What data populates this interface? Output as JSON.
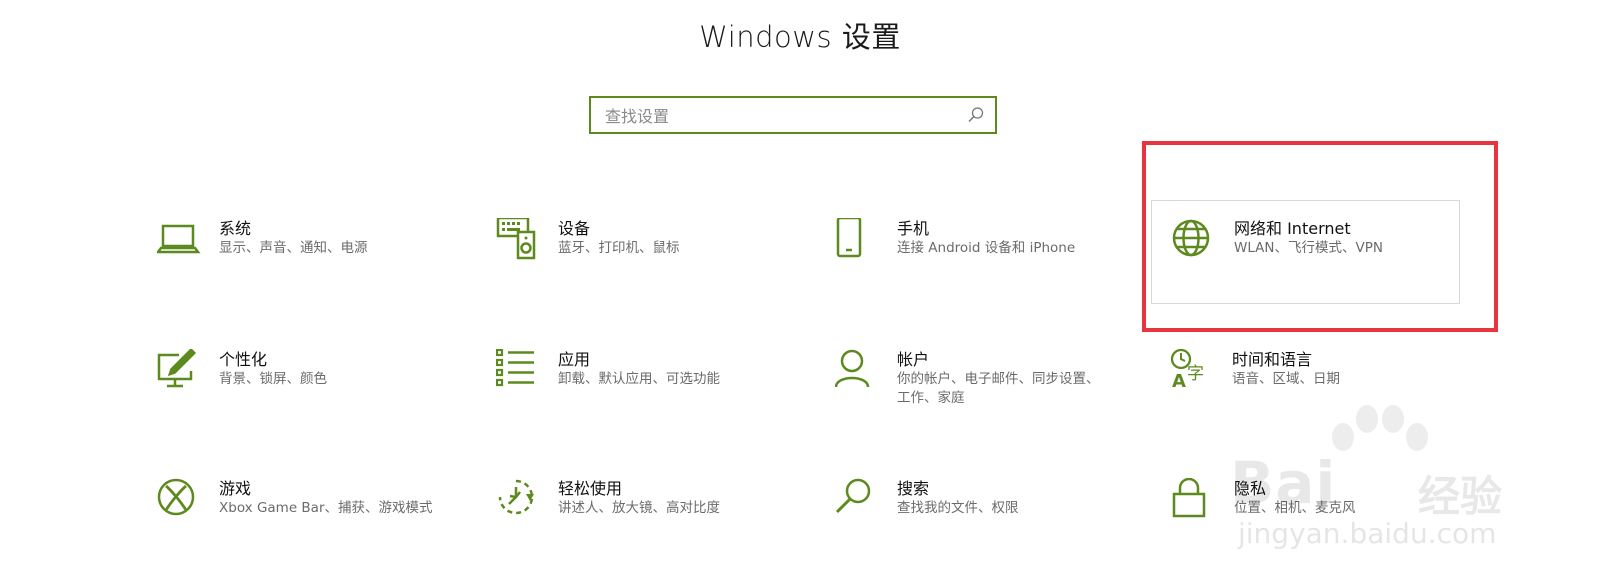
{
  "window": {
    "title": "Windows 设置"
  },
  "search": {
    "placeholder": "查找设置",
    "value": ""
  },
  "colors": {
    "accent": "#5d8a1f",
    "highlight": "#e8343f"
  },
  "tiles": [
    {
      "id": "system",
      "icon": "laptop-icon",
      "name": "系统",
      "desc": "显示、声音、通知、电源"
    },
    {
      "id": "devices",
      "icon": "devices-icon",
      "name": "设备",
      "desc": "蓝牙、打印机、鼠标"
    },
    {
      "id": "phone",
      "icon": "phone-icon",
      "name": "手机",
      "desc": "连接 Android 设备和 iPhone"
    },
    {
      "id": "network",
      "icon": "globe-icon",
      "name": "网络和 Internet",
      "desc": "WLAN、飞行模式、VPN"
    },
    {
      "id": "personal",
      "icon": "paint-icon",
      "name": "个性化",
      "desc": "背景、锁屏、颜色"
    },
    {
      "id": "apps",
      "icon": "apps-list-icon",
      "name": "应用",
      "desc": "卸载、默认应用、可选功能"
    },
    {
      "id": "accounts",
      "icon": "person-icon",
      "name": "帐户",
      "desc": "你的帐户、电子邮件、同步设置、工作、家庭"
    },
    {
      "id": "time",
      "icon": "time-language-icon",
      "name": "时间和语言",
      "desc": "语音、区域、日期"
    },
    {
      "id": "gaming",
      "icon": "xbox-icon",
      "name": "游戏",
      "desc": "Xbox Game Bar、捕获、游戏模式"
    },
    {
      "id": "ease",
      "icon": "ease-of-access-icon",
      "name": "轻松使用",
      "desc": "讲述人、放大镜、高对比度"
    },
    {
      "id": "search",
      "icon": "magnifier-icon",
      "name": "搜索",
      "desc": "查找我的文件、权限"
    },
    {
      "id": "privacy",
      "icon": "lock-icon",
      "name": "隐私",
      "desc": "位置、相机、麦克风"
    }
  ],
  "watermark": {
    "brand": "Bai",
    "brand_tail": "经验",
    "url": "jingyan.baidu.com"
  }
}
